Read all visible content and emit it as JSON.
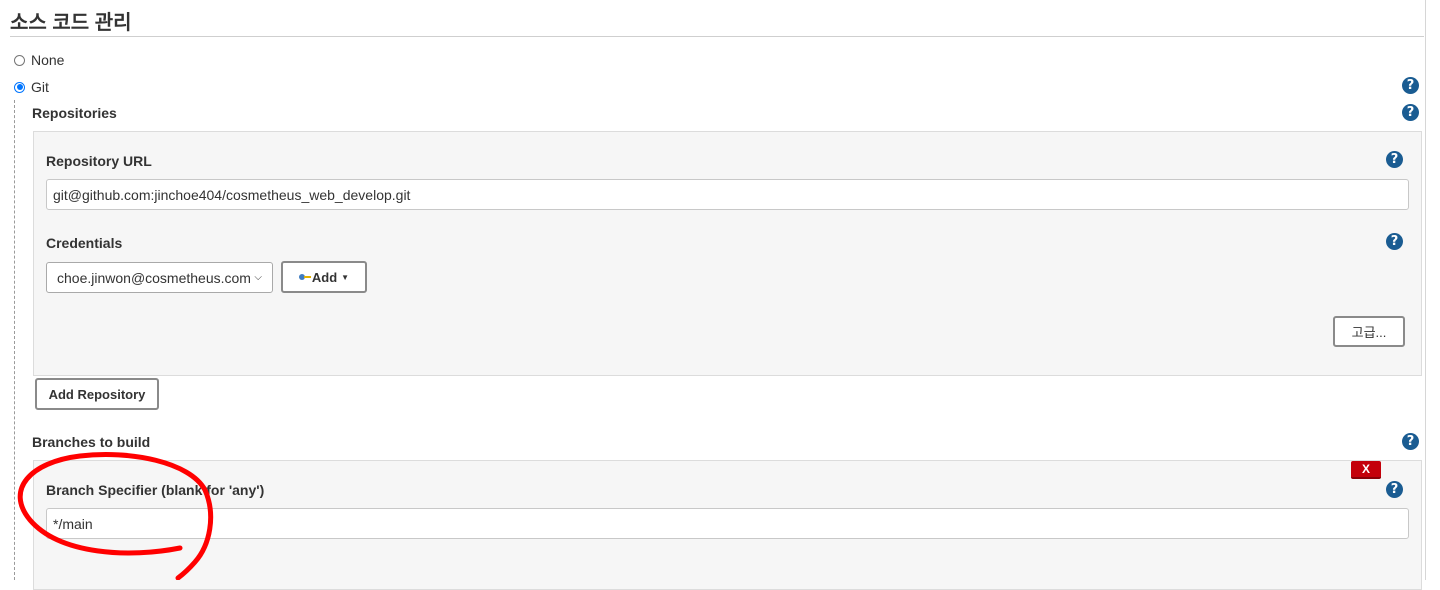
{
  "section": {
    "title": "소스 코드 관리"
  },
  "scm_options": [
    {
      "label": "None",
      "selected": false
    },
    {
      "label": "Git",
      "selected": true
    }
  ],
  "repositories": {
    "label": "Repositories",
    "url_label": "Repository URL",
    "url_value": "git@github.com:jinchoe404/cosmetheus_web_develop.git",
    "credentials_label": "Credentials",
    "credentials_selected": "choe.jinwon@cosmetheus.com",
    "add_label": "Add",
    "advanced_label": "고급...",
    "add_repository_label": "Add Repository"
  },
  "branches": {
    "label": "Branches to build",
    "delete_label": "X",
    "specifier_label": "Branch Specifier (blank for 'any')",
    "specifier_value": "*/main"
  },
  "help_icon_glyph": "?",
  "colors": {
    "help_icon": "#1a5c92",
    "radio_selected": "#0075ff",
    "delete_button": "#c4000a",
    "annotation_stroke": "#ff0000"
  },
  "icons": {
    "help": "question-circle-icon",
    "add": "key-icon",
    "dropdown": "caret-down-icon"
  }
}
